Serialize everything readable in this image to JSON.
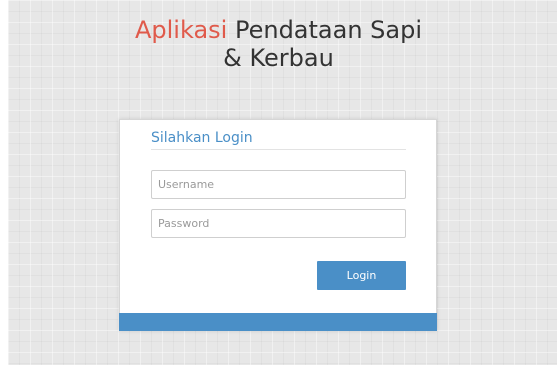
{
  "header": {
    "title_accent": "Aplikasi",
    "title_rest": "Pendataan Sapi",
    "title_line2": "& Kerbau"
  },
  "login_form": {
    "heading": "Silahkan Login",
    "username_placeholder": "Username",
    "password_placeholder": "Password",
    "submit_label": "Login"
  },
  "colors": {
    "accent": "#e05a4b",
    "primary": "#4a8fc7"
  }
}
